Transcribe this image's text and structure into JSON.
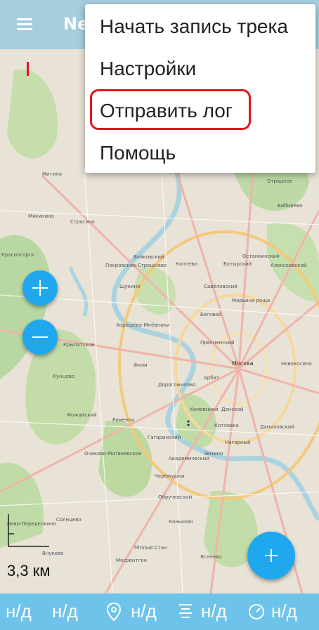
{
  "app": {
    "title_fragment": "Ne"
  },
  "menu": {
    "items": [
      "Начать запись трека",
      "Настройки",
      "Отправить лог",
      "Помощь"
    ],
    "highlighted_index": 2
  },
  "map": {
    "labels": [
      "Москва",
      "Фили",
      "Кунцево",
      "Крылатское",
      "Строгино",
      "Хорошёво-Мнёвники",
      "Щукино",
      "Покровское-Стрешнево",
      "Войковский",
      "Коптево",
      "Бутырский",
      "Марьина роща",
      "Останкинский",
      "Алексеевский",
      "Савёловский",
      "Беговой",
      "Пресненский",
      "Арбат",
      "Хамовники",
      "Дорогомилово",
      "Раменки",
      "Можайский",
      "Очаково-Матвеевское",
      "Гагаринский",
      "Академический",
      "Черёмушки",
      "Обручевский",
      "Коньково",
      "Тёплый Стан",
      "Ясенево",
      "Зюзино",
      "Котловка",
      "Донской",
      "Даниловский",
      "Нагорный",
      "Солнцево",
      "Ново-Переделкино",
      "Внуково",
      "Мосрентген",
      "Красногорск",
      "Мякинино",
      "Митино",
      "Новокосино",
      "Отрадное",
      "Бибирево"
    ],
    "scale_label": "3,3 км"
  },
  "controls": {
    "zoom_in_icon": "plus-icon",
    "zoom_out_icon": "minus-icon",
    "add_icon": "plus-icon"
  },
  "status_bar": {
    "field1": "н/д",
    "field2": "н/д",
    "field3": "н/д",
    "field4": "н/д",
    "field5": "н/д",
    "icon_location": "location-pin-icon",
    "icon_altitude": "altitude-icon",
    "icon_speed": "speedometer-icon"
  },
  "colors": {
    "accent_fab": "#1fa8ee",
    "status_bar": "#6ec3ea",
    "highlight": "#e2141b"
  }
}
